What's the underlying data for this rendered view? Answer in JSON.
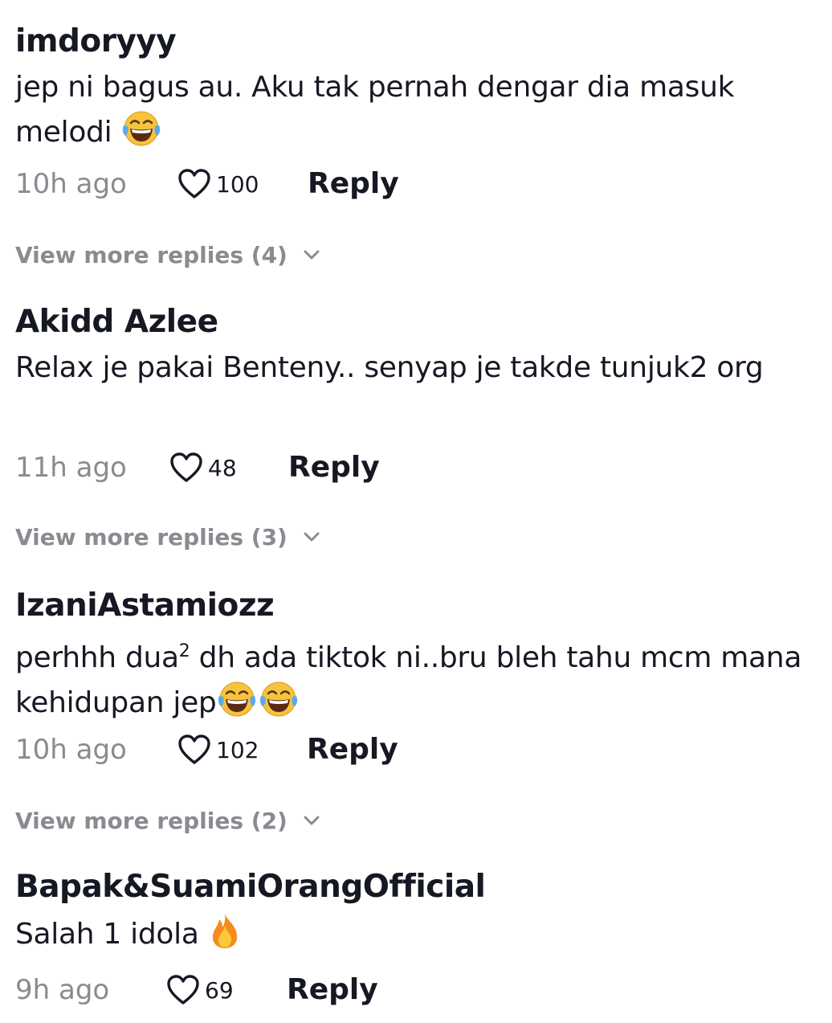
{
  "comments": [
    {
      "username": "imdoryyy",
      "text": "jep ni bagus au. Aku tak pernah dengar dia masuk melodi",
      "emoji": "laughing-tears-emoji",
      "time": "10h ago",
      "likes": "100",
      "reply_label": "Reply"
    },
    {
      "username": "Akidd Azlee",
      "text": "Relax je pakai Benteny.. senyap je takde tunjuk2 org",
      "time": "11h ago",
      "likes": "48",
      "reply_label": "Reply"
    },
    {
      "username": "IzaniAstamiozz",
      "text_before": "perhhh dua",
      "superscript": "2",
      "text_after": " dh ada tiktok ni..bru bleh tahu mcm mana kehidupan jep",
      "emoji": "laughing-tears-emoji",
      "time": "10h ago",
      "likes": "102",
      "reply_label": "Reply"
    },
    {
      "username": "Bapak&SuamiOrangOfficial",
      "text": "Salah 1 idola ",
      "emoji": "fire-emoji",
      "time": "9h ago",
      "likes": "69",
      "reply_label": "Reply"
    }
  ],
  "view_more": [
    "View more replies (4)",
    "View more replies (3)",
    "View more replies (2)"
  ],
  "colors": {
    "text": "#161823",
    "muted": "#8a8b91",
    "background": "#ffffff"
  }
}
